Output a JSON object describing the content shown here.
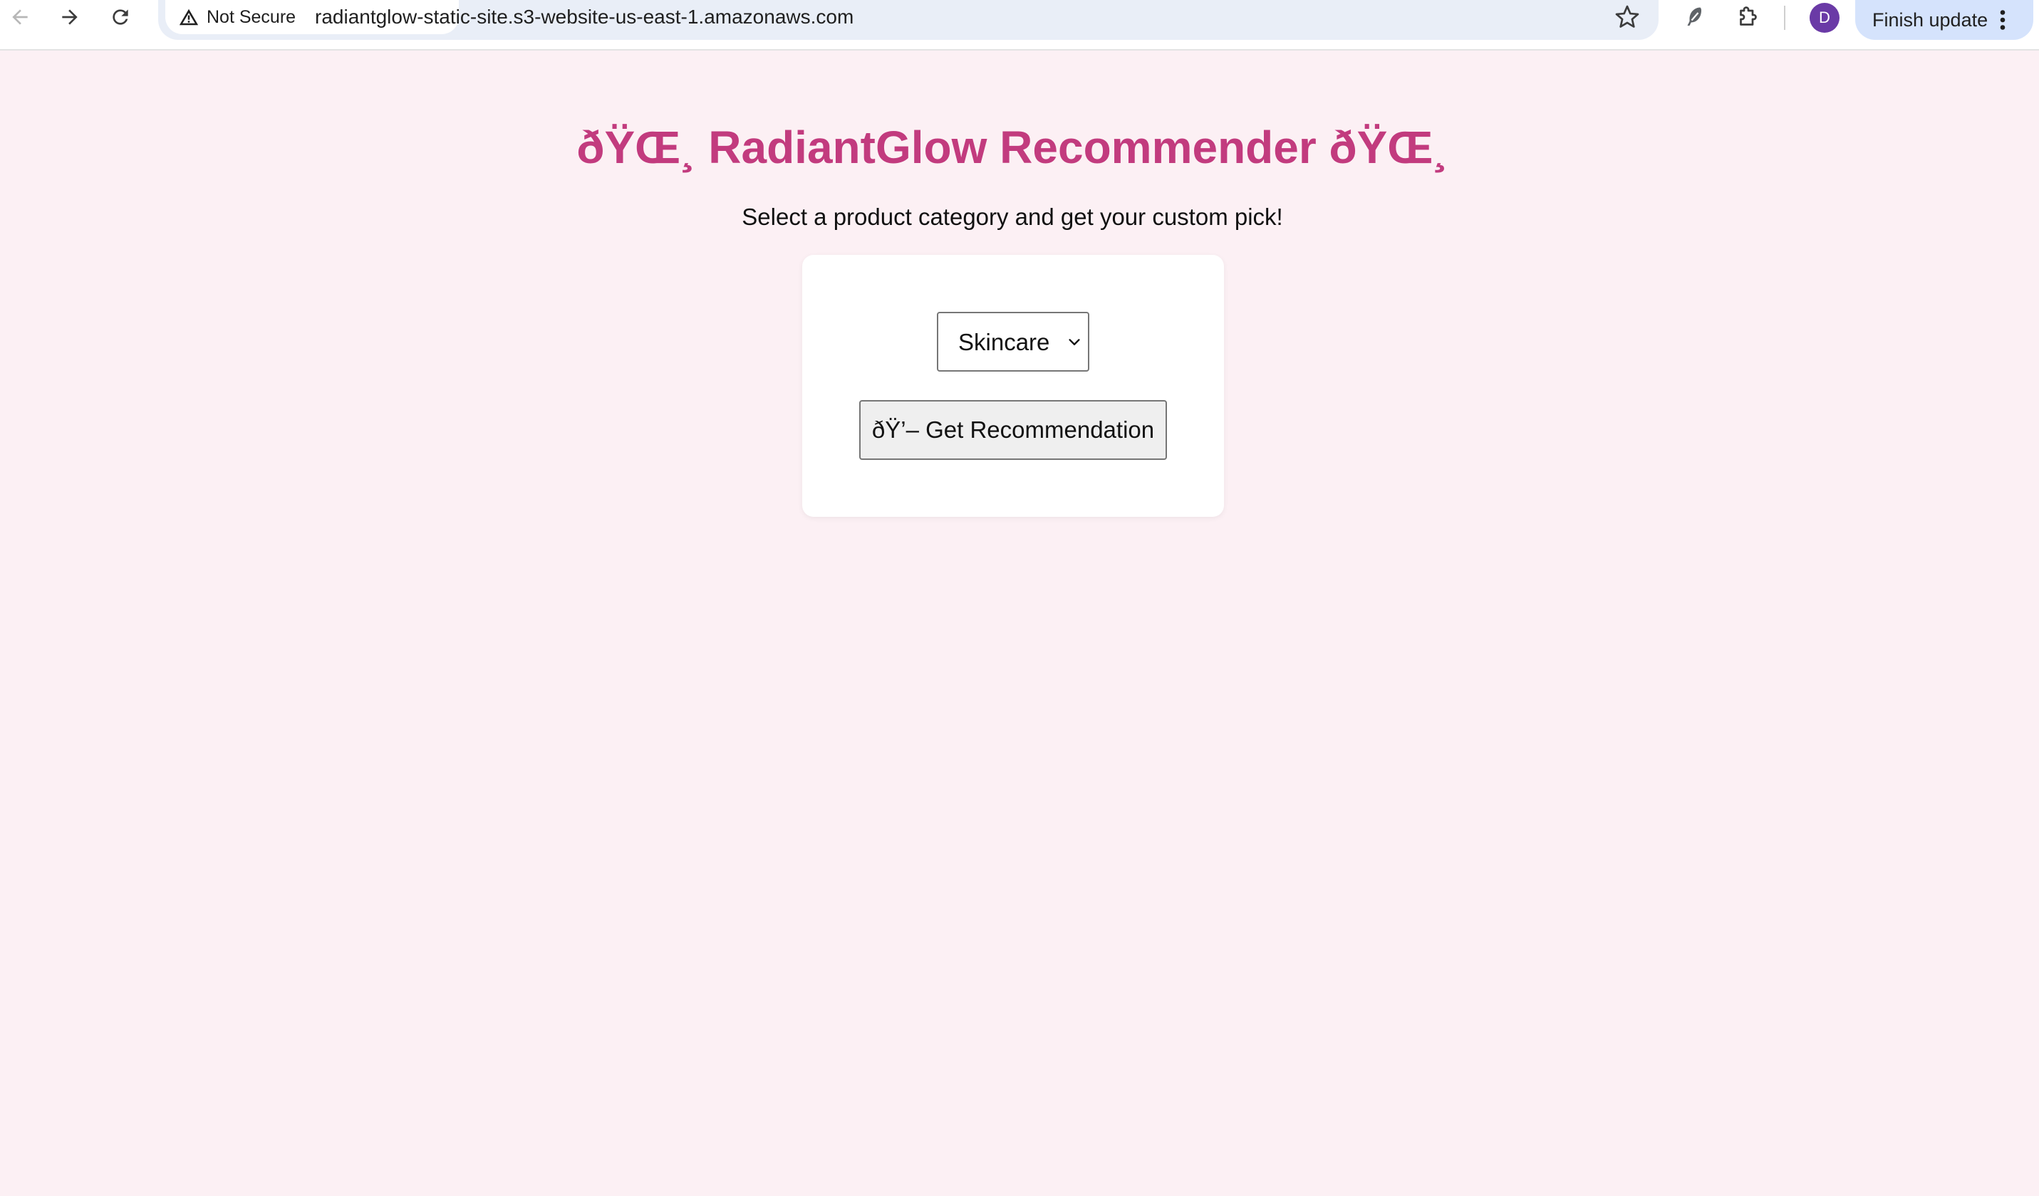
{
  "browser": {
    "security_label": "Not Secure",
    "url": "radiantglow-static-site.s3-website-us-east-1.amazonaws.com",
    "profile_initial": "D",
    "update_label": "Finish update",
    "icons": [
      "back-icon",
      "forward-icon",
      "reload-icon",
      "warning-icon",
      "star-icon",
      "feather-extension-icon",
      "puzzle-icon",
      "more-vert-icon"
    ]
  },
  "page": {
    "title": "ðŸŒ¸ RadiantGlow Recommender ðŸŒ¸",
    "subtitle": "Select a product category and get your custom pick!",
    "category_select": {
      "selected": "Skincare"
    },
    "recommend_button": "ðŸ’– Get Recommendation"
  },
  "colors": {
    "background": "#fcf0f4",
    "title": "#c23b7e",
    "card": "#ffffff",
    "avatar": "#6a3aa6",
    "update_button": "#d5e3fc"
  }
}
